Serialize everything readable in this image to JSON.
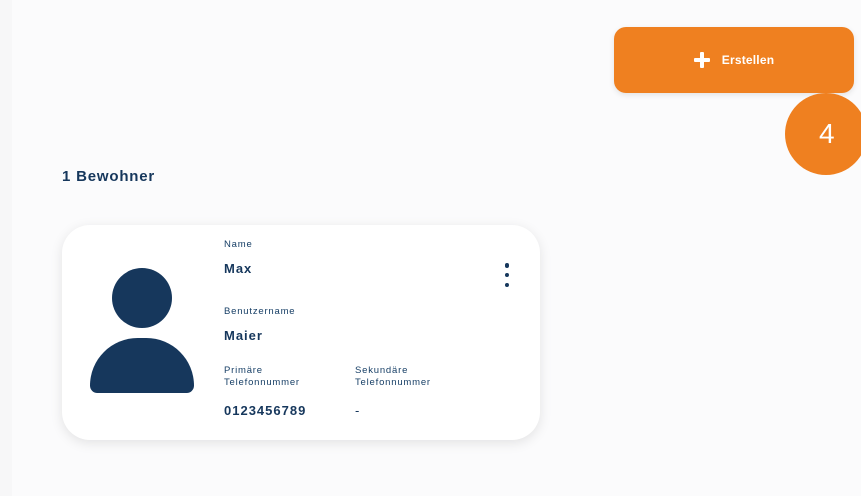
{
  "actions": {
    "create_label": "Erstellen",
    "create_icon": "plus-icon"
  },
  "annotation": {
    "step_number": "4"
  },
  "residents": {
    "count_label": "1 Bewohner",
    "cards": [
      {
        "name_label": "Name",
        "name": "Max",
        "username_label": "Benutzername",
        "username": "Maier",
        "primary_phone_label": "Primäre\nTelefonnummer",
        "primary_phone": "0123456789",
        "secondary_phone_label": "Sekundäre\nTelefonnummer",
        "secondary_phone": "-",
        "avatar_icon": "person-silhouette-icon",
        "menu_icon": "vertical-ellipsis-icon"
      }
    ]
  },
  "colors": {
    "accent": "#ef8020",
    "primary_text": "#16375c",
    "card_background": "#ffffff",
    "page_background": "#fbfbfc"
  }
}
